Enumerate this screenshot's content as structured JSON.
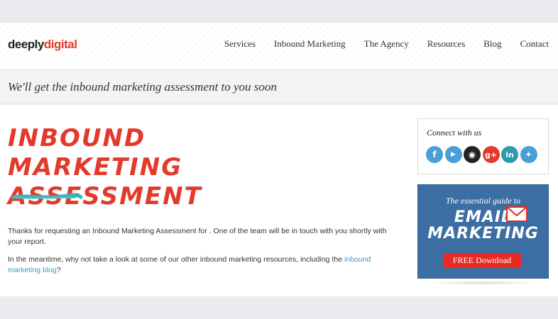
{
  "header": {
    "logo": {
      "part1": "deeply",
      "part2": "digital"
    },
    "nav": [
      "Services",
      "Inbound Marketing",
      "The Agency",
      "Resources",
      "Blog",
      "Contact"
    ]
  },
  "banner": {
    "text": "We'll get the inbound marketing assessment to you soon"
  },
  "main": {
    "title_line1": "INBOUND MARKETING",
    "title_line2": "ASSESSMENT",
    "para1": "Thanks for requesting an Inbound Marketing Assessment for . One of the team will be in touch with you shortly with your report.",
    "para2_prefix": "In the meantime,  why not take a look at some of our other inbound marketing resources, including the ",
    "para2_link": "inbound marketing blog",
    "para2_suffix": "?"
  },
  "sidebar": {
    "connect_title": "Connect with us",
    "social": [
      {
        "name": "facebook-icon",
        "glyph": "f",
        "color": "#4a9fd8"
      },
      {
        "name": "youtube-icon",
        "glyph": "▶",
        "color": "#4a9fd8"
      },
      {
        "name": "rss-icon",
        "glyph": "◉",
        "color": "#222222"
      },
      {
        "name": "google-plus-icon",
        "glyph": "g+",
        "color": "#e23a2c"
      },
      {
        "name": "linkedin-icon",
        "glyph": "in",
        "color": "#2f9aa9"
      },
      {
        "name": "twitter-icon",
        "glyph": "✦",
        "color": "#4a9fd8"
      }
    ],
    "promo": {
      "subtitle": "The essential guide to",
      "line1": "EMAIL",
      "line2": "MARKETING",
      "button": "FREE Download"
    }
  },
  "colors": {
    "accent_red": "#e43a2c",
    "link_blue": "#3a9bbd",
    "promo_blue": "#3d6ea3",
    "brush_teal": "#3ab3b8"
  }
}
